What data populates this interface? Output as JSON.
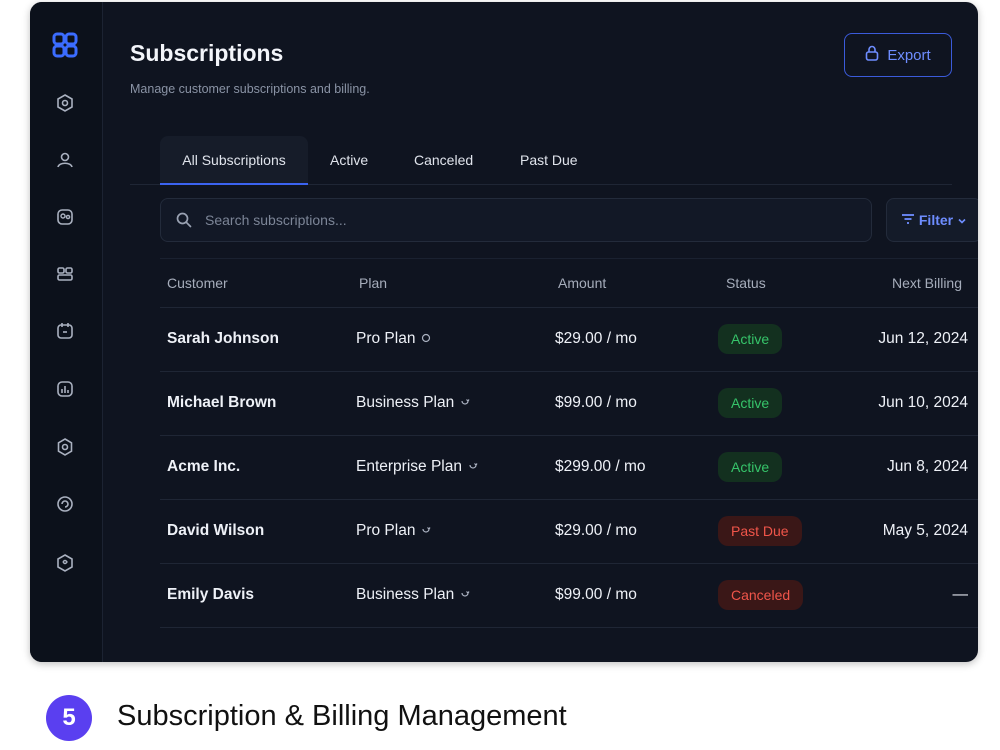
{
  "header": {
    "title": "Subscriptions",
    "subtitle": "Manage customer subscriptions and billing.",
    "export_label": "Export"
  },
  "tabs": [
    {
      "label": "All Subscriptions",
      "active": true
    },
    {
      "label": "Active",
      "active": false
    },
    {
      "label": "Canceled",
      "active": false
    },
    {
      "label": "Past Due",
      "active": false
    }
  ],
  "search": {
    "placeholder": "Search subscriptions..."
  },
  "filter": {
    "label": "Filter"
  },
  "table": {
    "columns": [
      "Customer",
      "Plan",
      "Amount",
      "Status",
      "Next Billing"
    ],
    "rows": [
      {
        "customer": "Sarah Johnson",
        "plan": "Pro Plan",
        "amount": "$29.00 / mo",
        "status": "Active",
        "status_type": "active",
        "next_billing": "Jun 12, 2024"
      },
      {
        "customer": "Michael Brown",
        "plan": "Business Plan",
        "amount": "$99.00 / mo",
        "status": "Active",
        "status_type": "active",
        "next_billing": "Jun 10, 2024"
      },
      {
        "customer": "Acme Inc.",
        "plan": "Enterprise Plan",
        "amount": "$299.00 / mo",
        "status": "Active",
        "status_type": "active",
        "next_billing": "Jun 8, 2024"
      },
      {
        "customer": "David Wilson",
        "plan": "Pro Plan",
        "amount": "$29.00 / mo",
        "status": "Past Due",
        "status_type": "pastdue",
        "next_billing": "May 5, 2024"
      },
      {
        "customer": "Emily Davis",
        "plan": "Business Plan",
        "amount": "$99.00 / mo",
        "status": "Canceled",
        "status_type": "canceled",
        "next_billing": "—"
      }
    ]
  },
  "sidebar": {
    "icons": [
      "logo-icon",
      "dashboard-icon",
      "user-icon",
      "users-icon",
      "grid-icon",
      "calendar-icon",
      "chart-icon",
      "settings-icon",
      "refresh-icon",
      "support-icon"
    ]
  },
  "footer": {
    "step_number": "5",
    "caption": "Subscription & Billing Management"
  },
  "colors": {
    "accent": "#3b63f0",
    "active_green": "#36c46a",
    "danger_red": "#f0554a",
    "background": "#0f1420"
  }
}
